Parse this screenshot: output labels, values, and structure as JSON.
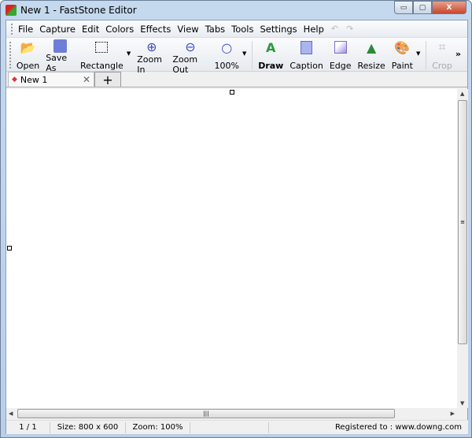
{
  "window": {
    "title": "New 1 - FastStone Editor",
    "minimize": "▭",
    "maximize": "▢",
    "close": "X"
  },
  "menu": {
    "items": [
      "File",
      "Capture",
      "Edit",
      "Colors",
      "Effects",
      "View",
      "Tabs",
      "Tools",
      "Settings",
      "Help"
    ],
    "undo": "↶",
    "redo": "↷"
  },
  "toolbar": {
    "open": "Open",
    "save_as": "Save As",
    "rectangle": "Rectangle",
    "zoom_in": "Zoom In",
    "zoom_out": "Zoom Out",
    "zoom_level": "100%",
    "draw": "Draw",
    "caption": "Caption",
    "edge": "Edge",
    "resize": "Resize",
    "paint": "Paint",
    "crop": "Crop",
    "more": "»"
  },
  "tabs": {
    "items": [
      {
        "label": "New 1"
      }
    ],
    "add": "+",
    "close": "✕"
  },
  "status": {
    "page": "1 / 1",
    "size": "Size: 800 x 600",
    "zoom": "Zoom: 100%",
    "registered": "Registered to : www.downg.com"
  },
  "colors": {
    "accent": "#c9462c",
    "frame": "#c4d8ee"
  }
}
